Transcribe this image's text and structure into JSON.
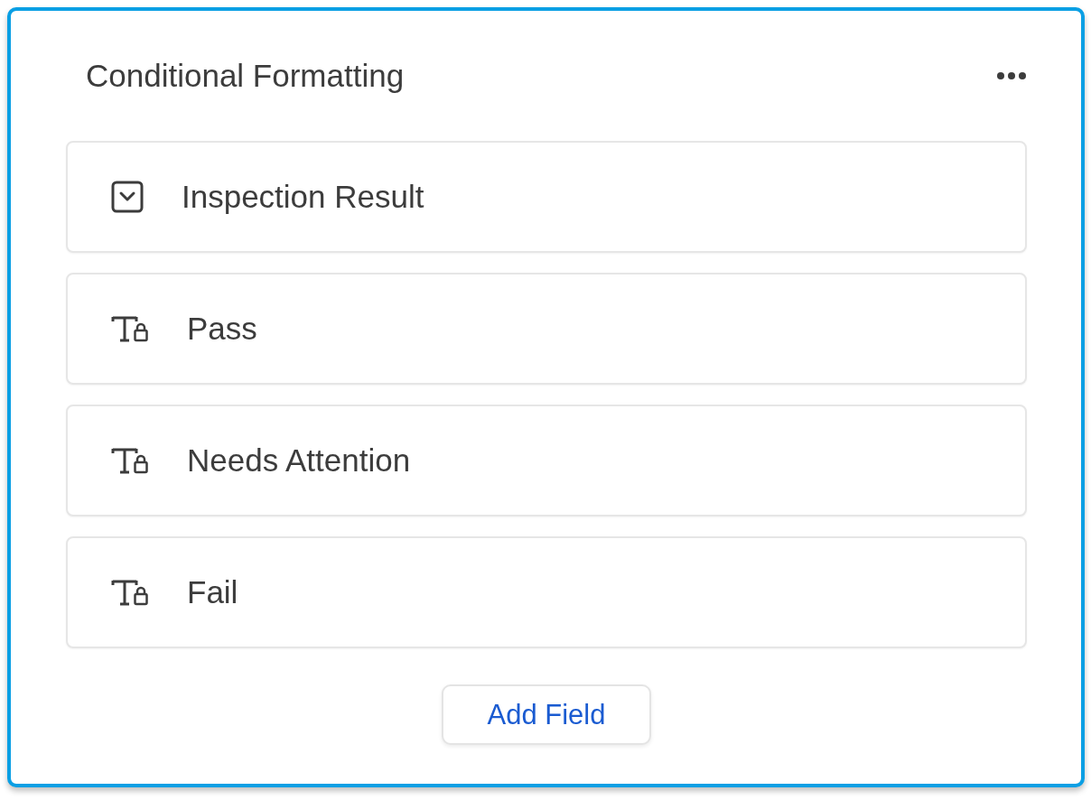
{
  "panel": {
    "title": "Conditional Formatting"
  },
  "fields": [
    {
      "kind": "dropdown",
      "label": "Inspection Result"
    },
    {
      "kind": "text",
      "label": "Pass"
    },
    {
      "kind": "text",
      "label": "Needs Attention"
    },
    {
      "kind": "text",
      "label": "Fail"
    }
  ],
  "add_button": "Add Field"
}
